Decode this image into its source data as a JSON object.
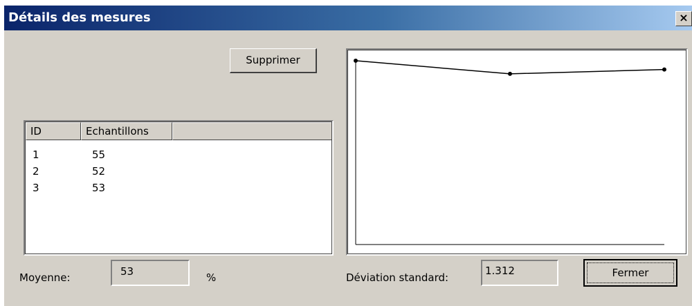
{
  "window": {
    "title": "Détails des mesures",
    "close_glyph": "×"
  },
  "buttons": {
    "delete_label": "Supprimer",
    "close_label": "Fermer"
  },
  "table": {
    "columns": [
      "ID",
      "Echantillons",
      ""
    ],
    "rows": [
      {
        "id": "1",
        "sample": "55"
      },
      {
        "id": "2",
        "sample": "52"
      },
      {
        "id": "3",
        "sample": "53"
      }
    ]
  },
  "stats": {
    "mean_label": "Moyenne:",
    "mean_value": "53",
    "mean_unit": "%",
    "stddev_label": "Déviation standard:",
    "stddev_value": "1.312"
  },
  "chart_data": {
    "type": "line",
    "x": [
      1,
      2,
      3
    ],
    "values": [
      55,
      52,
      53
    ],
    "ylim": [
      0,
      56
    ],
    "title": "",
    "xlabel": "",
    "ylabel": "",
    "grid": false
  }
}
